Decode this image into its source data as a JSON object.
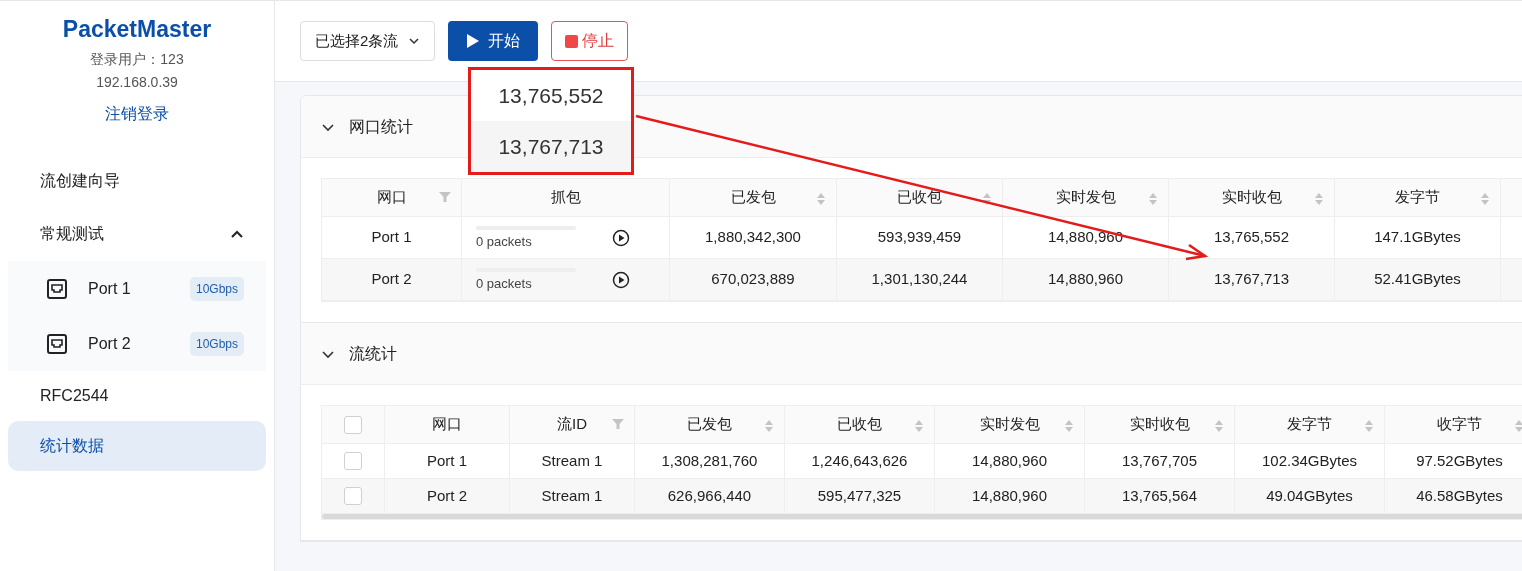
{
  "sidebar": {
    "logo": "PacketMaster",
    "user": "登录用户：123",
    "ip": "192.168.0.39",
    "logout": "注销登录",
    "nav": [
      {
        "kind": "item",
        "label": "流创建向导",
        "selected": false
      },
      {
        "kind": "group",
        "label": "常规测试",
        "expanded": true,
        "children": [
          {
            "label": "Port 1",
            "badge": "10Gbps",
            "selected": false
          },
          {
            "label": "Port 2",
            "badge": "10Gbps",
            "selected": false
          }
        ]
      },
      {
        "kind": "item",
        "label": "RFC2544",
        "selected": false
      },
      {
        "kind": "item",
        "label": "统计数据",
        "selected": true
      }
    ]
  },
  "toolbar": {
    "stream_select": "已选择2条流",
    "start": "开始",
    "stop": "停止"
  },
  "sections": [
    {
      "kind": "ports",
      "title": "网口统计",
      "expanded": true,
      "columns": [
        {
          "label": "网口",
          "kind": "filter"
        },
        {
          "label": "抓包",
          "kind": "plain"
        },
        {
          "label": "已发包",
          "kind": "sort"
        },
        {
          "label": "已收包",
          "kind": "sort"
        },
        {
          "label": "实时发包",
          "kind": "sort"
        },
        {
          "label": "实时收包",
          "kind": "sort"
        },
        {
          "label": "发字节",
          "kind": "sort"
        }
      ],
      "rows": [
        {
          "cells": [
            {
              "kind": "text",
              "text": "Port 1"
            },
            {
              "kind": "capture",
              "level": 0,
              "text": "0 packets"
            },
            {
              "kind": "text",
              "text": "1,880,342,300"
            },
            {
              "kind": "text",
              "text": "593,939,459"
            },
            {
              "kind": "text",
              "text": "14,880,960"
            },
            {
              "kind": "text",
              "text": "13,765,552"
            },
            {
              "kind": "text",
              "text": "147.1GBytes"
            }
          ]
        },
        {
          "cells": [
            {
              "kind": "text",
              "text": "Port 2"
            },
            {
              "kind": "capture",
              "level": 0,
              "text": "0 packets"
            },
            {
              "kind": "text",
              "text": "670,023,889"
            },
            {
              "kind": "text",
              "text": "1,301,130,244"
            },
            {
              "kind": "text",
              "text": "14,880,960"
            },
            {
              "kind": "text",
              "text": "13,767,713"
            },
            {
              "kind": "text",
              "text": "52.41GBytes"
            }
          ]
        }
      ]
    },
    {
      "kind": "flows",
      "title": "流统计",
      "expanded": true,
      "header_checked": false,
      "columns": [
        {
          "label": "网口",
          "kind": "plain"
        },
        {
          "label": "流ID",
          "kind": "filter"
        },
        {
          "label": "已发包",
          "kind": "sort"
        },
        {
          "label": "已收包",
          "kind": "sort"
        },
        {
          "label": "实时发包",
          "kind": "sort"
        },
        {
          "label": "实时收包",
          "kind": "sort"
        },
        {
          "label": "发字节",
          "kind": "sort"
        },
        {
          "label": "收字节",
          "kind": "sort"
        }
      ],
      "rows": [
        {
          "checked": false,
          "cells": [
            "Port 1",
            "Stream 1",
            "1,308,281,760",
            "1,246,643,626",
            "14,880,960",
            "13,767,705",
            "102.34GBytes",
            "97.52GBytes"
          ]
        },
        {
          "checked": false,
          "cells": [
            "Port 2",
            "Stream 1",
            "626,966,440",
            "595,477,325",
            "14,880,960",
            "13,765,564",
            "49.04GBytes",
            "46.58GBytes"
          ]
        }
      ]
    }
  ],
  "callout": {
    "values": [
      "13,765,552",
      "13,767,713"
    ]
  }
}
